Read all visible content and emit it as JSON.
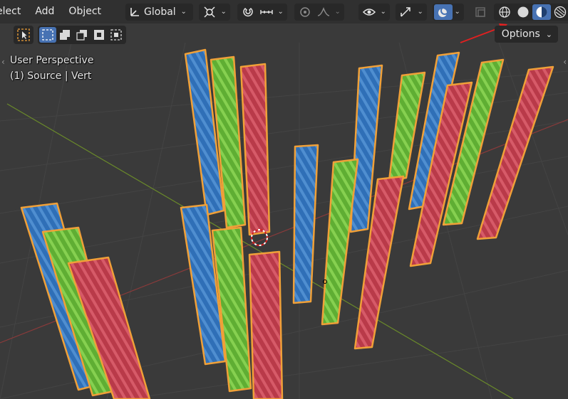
{
  "header": {
    "menus": [
      "elect",
      "Add",
      "Object"
    ],
    "orientation": "Global"
  },
  "toolbar": {
    "options_label": "Options"
  },
  "viewport": {
    "view_name": "User Perspective",
    "object_info": "(1) Source | Vert"
  },
  "colors": {
    "blue": "#2f6fb7",
    "green": "#6bbf3a",
    "red": "#c0404e",
    "selection_outline": "#f0a038",
    "active_button": "#4772b3",
    "annotation_arrow": "#e02020"
  },
  "icons": [
    "select-cursor-icon",
    "select-box-icon",
    "transform-orientation-icon",
    "pivot-icon",
    "snap-icon",
    "proportional-edit-icon",
    "visibility-icon",
    "gizmo-icon",
    "overlay-icon",
    "xray-icon",
    "wireframe-shading-icon",
    "solid-shading-icon",
    "material-preview-icon",
    "rendered-shading-icon"
  ]
}
